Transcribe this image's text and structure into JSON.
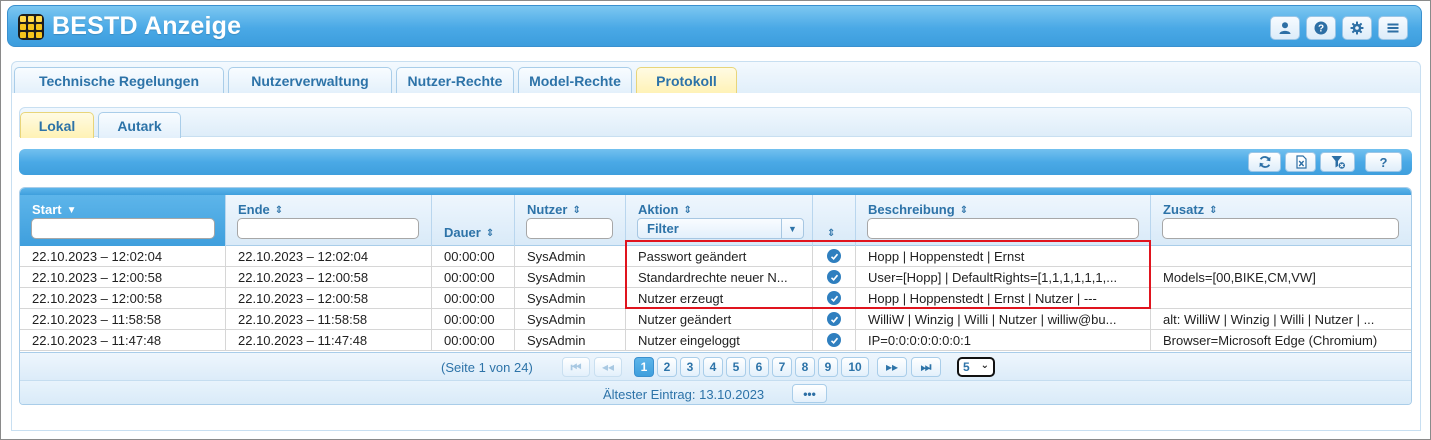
{
  "app": {
    "title": "BESTD Anzeige"
  },
  "header_buttons": [
    "user-icon",
    "help-icon",
    "gear-icon",
    "menu-icon"
  ],
  "main_tabs": [
    {
      "label": "Technische Regelungen",
      "active": false
    },
    {
      "label": "Nutzerverwaltung",
      "active": false
    },
    {
      "label": "Nutzer-Rechte",
      "active": false
    },
    {
      "label": "Model-Rechte",
      "active": false
    },
    {
      "label": "Protokoll",
      "active": true
    }
  ],
  "sub_tabs": [
    {
      "label": "Lokal",
      "active": true
    },
    {
      "label": "Autark",
      "active": false
    }
  ],
  "toolbar": {
    "buttons": [
      "refresh-icon",
      "excel-export-icon",
      "clear-filter-icon"
    ],
    "help_label": "?"
  },
  "table": {
    "columns": {
      "start": "Start",
      "ende": "Ende",
      "dauer": "Dauer",
      "nutzer": "Nutzer",
      "aktion": "Aktion",
      "beschreibung": "Beschreibung",
      "zusatz": "Zusatz"
    },
    "aktion_filter": "Filter",
    "rows": [
      {
        "start": "22.10.2023 – 12:02:04",
        "ende": "22.10.2023 – 12:02:04",
        "dauer": "00:00:00",
        "nutzer": "SysAdmin",
        "aktion": "Passwort geändert",
        "ok": true,
        "beschreibung": "Hopp | Hoppenstedt | Ernst",
        "zusatz": ""
      },
      {
        "start": "22.10.2023 – 12:00:58",
        "ende": "22.10.2023 – 12:00:58",
        "dauer": "00:00:00",
        "nutzer": "SysAdmin",
        "aktion": "Standardrechte neuer N...",
        "ok": true,
        "beschreibung": "User=[Hopp] | DefaultRights=[1,1,1,1,1,1,...",
        "zusatz": "Models=[00,BIKE,CM,VW]"
      },
      {
        "start": "22.10.2023 – 12:00:58",
        "ende": "22.10.2023 – 12:00:58",
        "dauer": "00:00:00",
        "nutzer": "SysAdmin",
        "aktion": "Nutzer erzeugt",
        "ok": true,
        "beschreibung": "Hopp | Hoppenstedt | Ernst | Nutzer | ---",
        "zusatz": ""
      },
      {
        "start": "22.10.2023 – 11:58:58",
        "ende": "22.10.2023 – 11:58:58",
        "dauer": "00:00:00",
        "nutzer": "SysAdmin",
        "aktion": "Nutzer geändert",
        "ok": true,
        "beschreibung": "WilliW | Winzig | Willi | Nutzer | williw@bu...",
        "zusatz": "alt: WilliW | Winzig | Willi | Nutzer | ..."
      },
      {
        "start": "22.10.2023 – 11:47:48",
        "ende": "22.10.2023 – 11:47:48",
        "dauer": "00:00:00",
        "nutzer": "SysAdmin",
        "aktion": "Nutzer eingeloggt",
        "ok": true,
        "beschreibung": "IP=0:0:0:0:0:0:0:1",
        "zusatz": "Browser=Microsoft Edge (Chromium)"
      }
    ]
  },
  "pager": {
    "info": "(Seite 1 von 24)",
    "pages": [
      "1",
      "2",
      "3",
      "4",
      "5",
      "6",
      "7",
      "8",
      "9",
      "10"
    ],
    "current_page": "1",
    "page_size": "5"
  },
  "footer": {
    "oldest_entry": "Ältester Eintrag: 13.10.2023",
    "more_label": "•••"
  },
  "colors": {
    "accent": "#4aa9e6",
    "active_tab": "#fff2b5",
    "highlight": "#e0141e",
    "text_blue": "#2d73a8"
  }
}
